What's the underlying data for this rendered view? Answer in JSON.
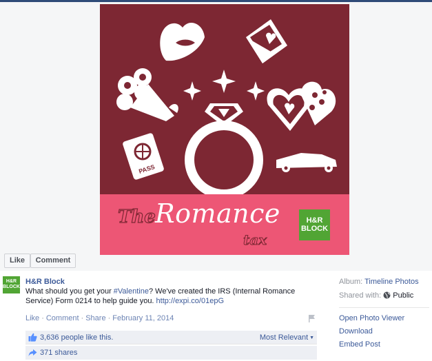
{
  "photo": {
    "title_the": "The",
    "title_main": "Romance",
    "title_tax": "tax",
    "brand_logo_line1": "H&R",
    "brand_logo_line2": "BLOCK",
    "passport_label": "PASS",
    "colors": {
      "background": "#7d2733",
      "banner": "#ed5675",
      "logo": "#51a534"
    }
  },
  "photo_actions": {
    "like_label": "Like",
    "comment_label": "Comment"
  },
  "post": {
    "avatar_line1": "H&R",
    "avatar_line2": "BLOCK",
    "page_name": "H&R Block",
    "caption_before": "What should you get your ",
    "hashtag": "#Valentine",
    "caption_after": "? We've created the IRS (Internal Romance Service) Form 0214 to help guide you. ",
    "link": "http://expi.co/01epG",
    "actions": {
      "like": "Like",
      "comment": "Comment",
      "share": "Share",
      "date": "February 11, 2014"
    },
    "likes_text": "3,636 people like this.",
    "sort_label": "Most Relevant",
    "shares_text": "371 shares"
  },
  "sidebar": {
    "album_label": "Album:",
    "album_value": "Timeline Photos",
    "shared_label": "Shared with:",
    "shared_value": "Public",
    "links": [
      "Open Photo Viewer",
      "Download",
      "Embed Post"
    ]
  }
}
